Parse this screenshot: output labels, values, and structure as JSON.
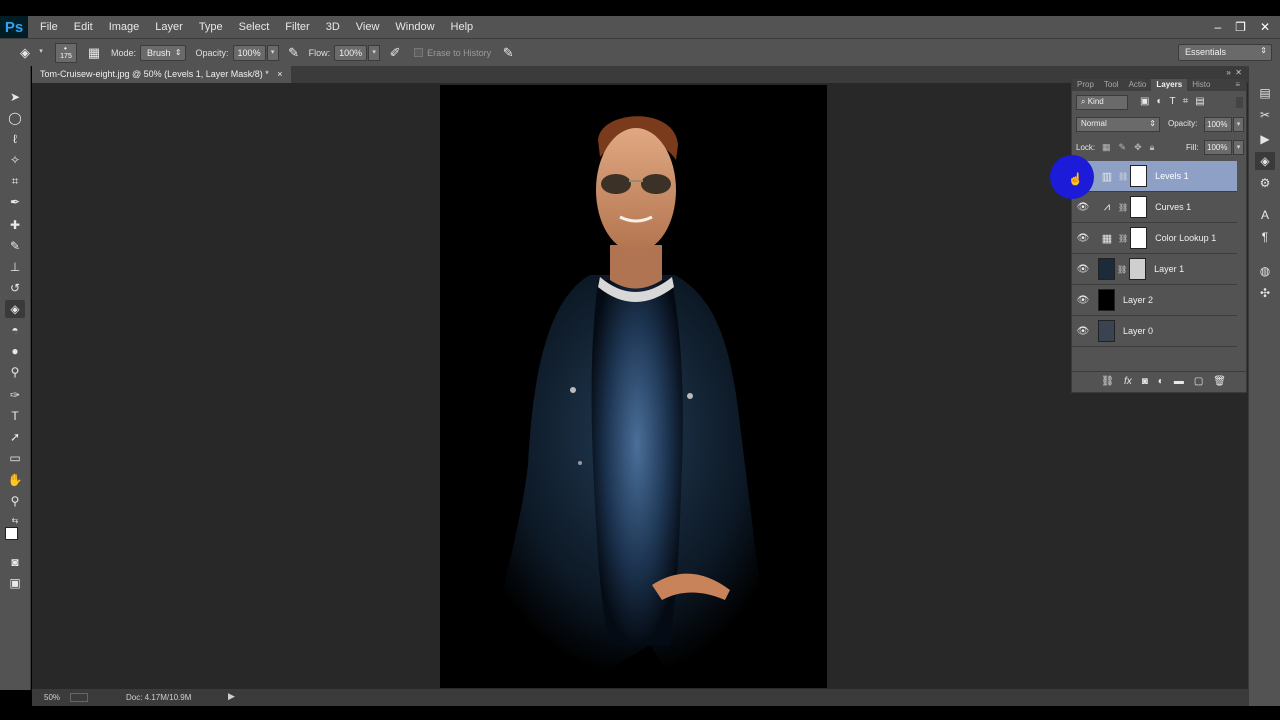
{
  "app": {
    "logo": "Ps"
  },
  "menu": [
    "File",
    "Edit",
    "Image",
    "Layer",
    "Type",
    "Select",
    "Filter",
    "3D",
    "View",
    "Window",
    "Help"
  ],
  "options": {
    "brush_size": "175",
    "mode_label": "Mode:",
    "mode_value": "Brush",
    "opacity_label": "Opacity:",
    "opacity_value": "100%",
    "flow_label": "Flow:",
    "flow_value": "100%",
    "erase_history_label": "Erase to History",
    "workspace": "Essentials"
  },
  "document": {
    "tab_title": "Tom-Cruisew-eight.jpg @ 50% (Levels 1, Layer Mask/8) *",
    "zoom": "50%",
    "doc_info": "Doc: 4.17M/10.9M"
  },
  "layers_panel": {
    "tabs": [
      "Prop",
      "Tool",
      "Actio",
      "Layers",
      "Histo"
    ],
    "kind_label": "Kind",
    "blend_mode": "Normal",
    "opacity_label": "Opacity:",
    "opacity_value": "100%",
    "lock_label": "Lock:",
    "fill_label": "Fill:",
    "fill_value": "100%",
    "layers": [
      {
        "name": "Levels 1",
        "selected": true
      },
      {
        "name": "Curves 1"
      },
      {
        "name": "Color Lookup 1"
      },
      {
        "name": "Layer 1"
      },
      {
        "name": "Layer 2"
      },
      {
        "name": "Layer 0"
      }
    ]
  },
  "colors": {
    "accent": "#2fa3f6",
    "selected_layer": "#8fa0c6",
    "cursor_highlight": "#1b1bd8"
  }
}
